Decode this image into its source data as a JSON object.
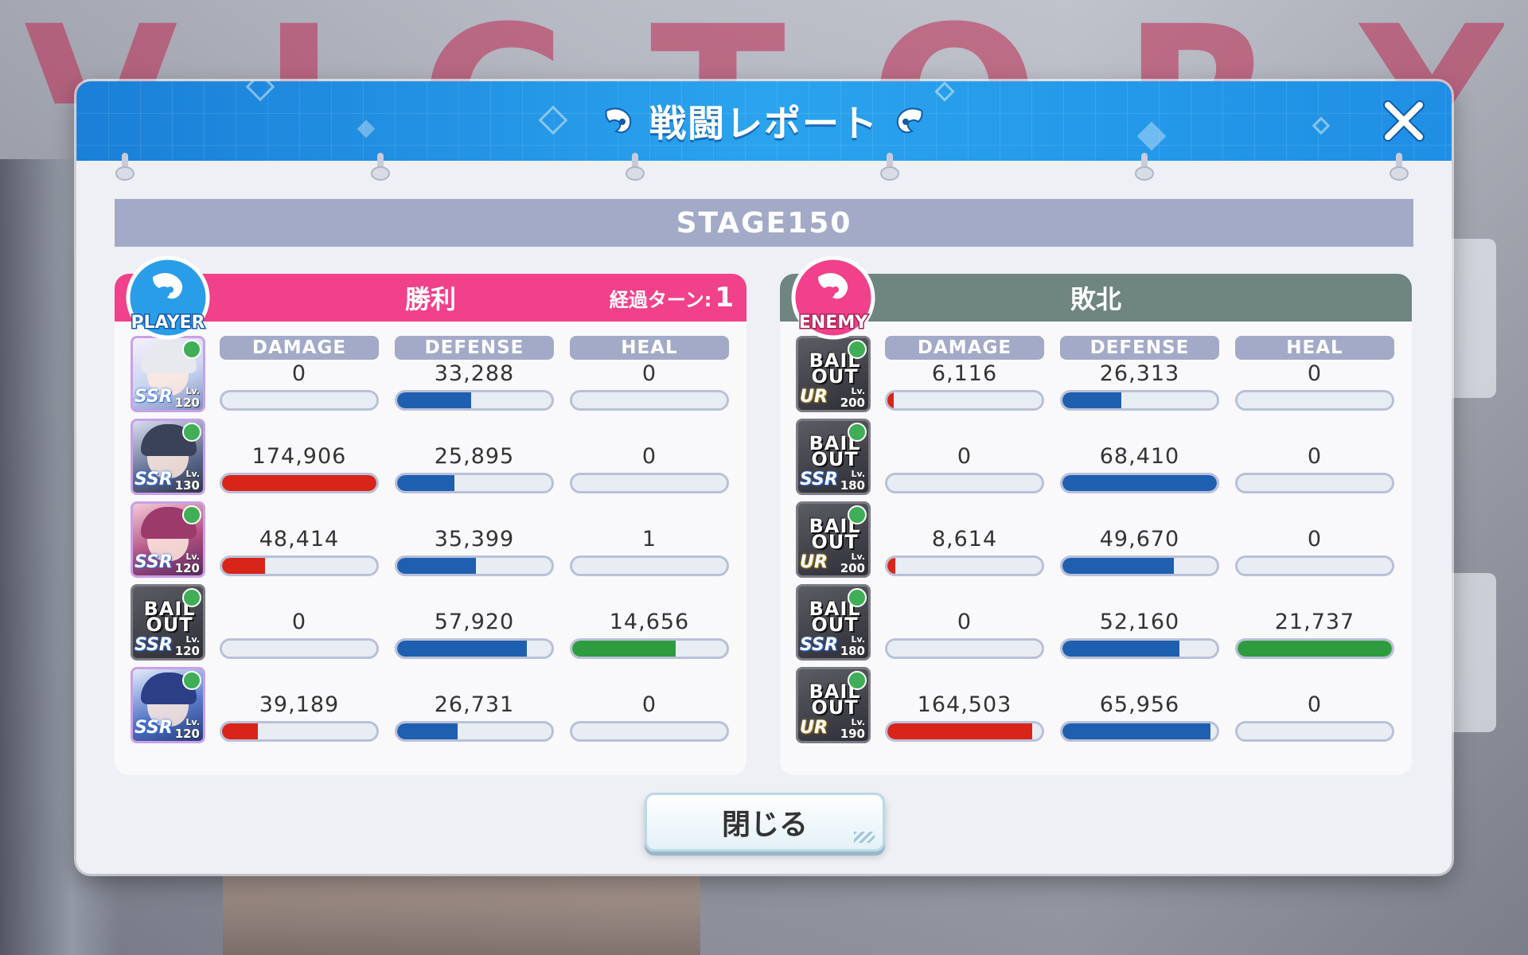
{
  "background": {
    "victory_letters": [
      "V",
      "I",
      "C",
      "T",
      "O",
      "R",
      "Y"
    ]
  },
  "header": {
    "title": "戦闘レポート"
  },
  "stage": {
    "label": "STAGE150"
  },
  "player": {
    "badge": "PLAYER",
    "result": "勝利",
    "turns_label": "経過ターン:",
    "turns_value": "1",
    "rows": [
      {
        "portrait": "character",
        "rarity": "SSR",
        "level": "120",
        "damage": "0",
        "defense": "33,288",
        "heal": "0",
        "damage_frac": 0.0,
        "defense_frac": 0.48,
        "heal_frac": 0.0
      },
      {
        "portrait": "character",
        "rarity": "SSR",
        "level": "130",
        "damage": "174,906",
        "defense": "25,895",
        "heal": "0",
        "damage_frac": 1.0,
        "defense_frac": 0.37,
        "heal_frac": 0.0
      },
      {
        "portrait": "character",
        "rarity": "SSR",
        "level": "120",
        "damage": "48,414",
        "defense": "35,399",
        "heal": "1",
        "damage_frac": 0.28,
        "defense_frac": 0.51,
        "heal_frac": 0.0
      },
      {
        "portrait": "bail_out",
        "bail_text": "BAIL OUT",
        "rarity": "SSR",
        "level": "120",
        "damage": "0",
        "defense": "57,920",
        "heal": "14,656",
        "damage_frac": 0.0,
        "defense_frac": 0.84,
        "heal_frac": 0.67
      },
      {
        "portrait": "character",
        "rarity": "SSR",
        "level": "120",
        "damage": "39,189",
        "defense": "26,731",
        "heal": "0",
        "damage_frac": 0.23,
        "defense_frac": 0.39,
        "heal_frac": 0.0
      }
    ]
  },
  "enemy": {
    "badge": "ENEMY",
    "result": "敗北",
    "rows": [
      {
        "portrait": "bail_out",
        "bail_text": "BAIL OUT",
        "rarity": "UR",
        "level": "200",
        "damage": "6,116",
        "defense": "26,313",
        "heal": "0",
        "damage_frac": 0.04,
        "defense_frac": 0.38,
        "heal_frac": 0.0
      },
      {
        "portrait": "bail_out",
        "bail_text": "BAIL OUT",
        "rarity": "SSR",
        "level": "180",
        "damage": "0",
        "defense": "68,410",
        "heal": "0",
        "damage_frac": 0.0,
        "defense_frac": 1.0,
        "heal_frac": 0.0
      },
      {
        "portrait": "bail_out",
        "bail_text": "BAIL OUT",
        "rarity": "UR",
        "level": "200",
        "damage": "8,614",
        "defense": "49,670",
        "heal": "0",
        "damage_frac": 0.05,
        "defense_frac": 0.72,
        "heal_frac": 0.0
      },
      {
        "portrait": "bail_out",
        "bail_text": "BAIL OUT",
        "rarity": "SSR",
        "level": "180",
        "damage": "0",
        "defense": "52,160",
        "heal": "21,737",
        "damage_frac": 0.0,
        "defense_frac": 0.76,
        "heal_frac": 1.0
      },
      {
        "portrait": "bail_out",
        "bail_text": "BAIL OUT",
        "rarity": "UR",
        "level": "190",
        "damage": "164,503",
        "defense": "65,956",
        "heal": "0",
        "damage_frac": 0.94,
        "defense_frac": 0.96,
        "heal_frac": 0.0
      }
    ]
  },
  "columns": {
    "damage": "DAMAGE",
    "defense": "DEFENSE",
    "heal": "HEAL"
  },
  "level_prefix": "Lv.",
  "buttons": {
    "close_bottom": "閉じる"
  },
  "colors": {
    "header_blue": "#1f8fe5",
    "player_pink": "#f0418a",
    "enemy_gray": "#6e8580",
    "damage_red": "#d9241a",
    "defense_blue": "#1e5fb0",
    "heal_green": "#2e9c3e",
    "label_lavender": "#a3aac8"
  }
}
